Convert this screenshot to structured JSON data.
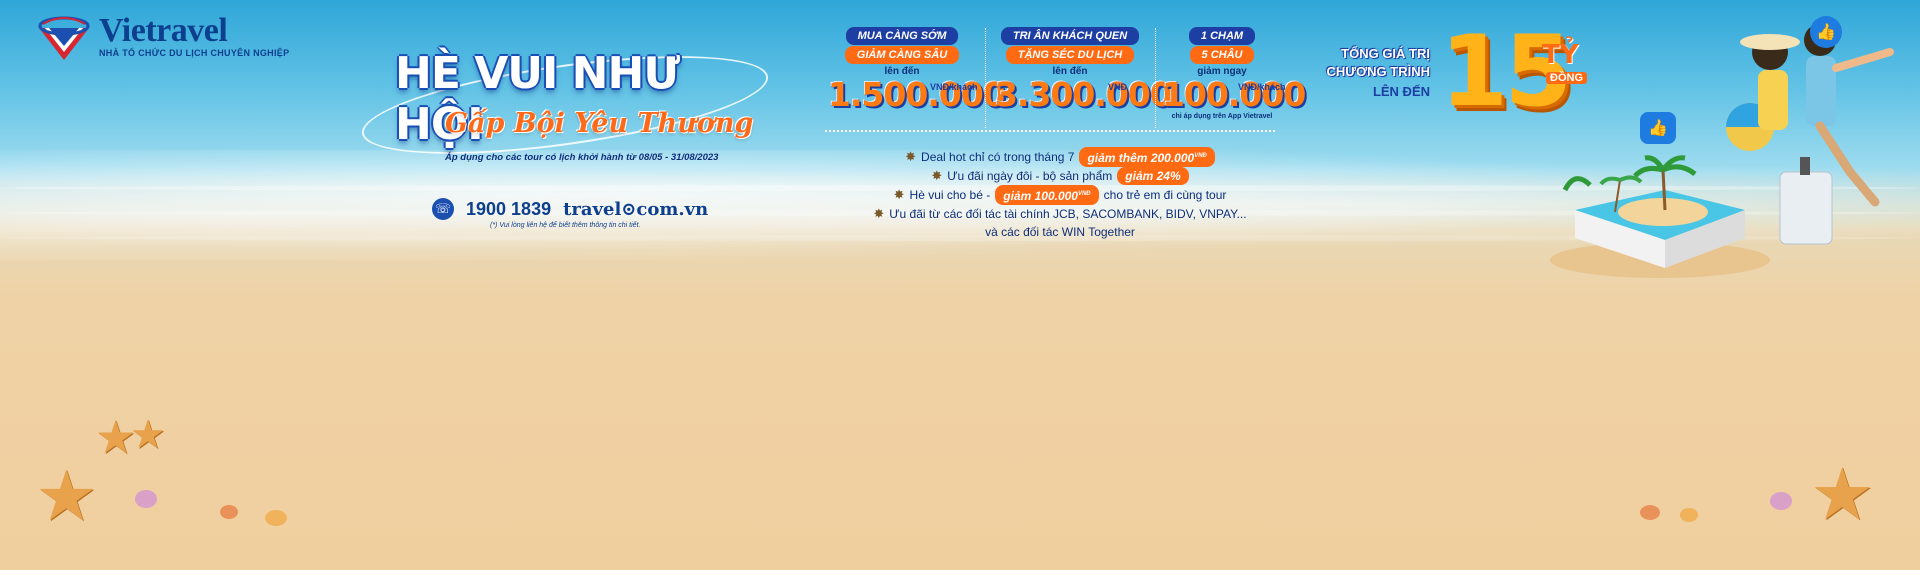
{
  "brand": {
    "name": "Vietravel",
    "tagline": "NHÀ TỔ CHỨC DU LỊCH CHUYÊN NGHIỆP",
    "logo_icon": "vietravel-logo-icon"
  },
  "campaign": {
    "title": "HÈ VUI NHƯ HỘI",
    "subtitle": "Gấp Bội Yêu Thương",
    "note": "Áp dụng cho các tour có lịch khởi hành từ 08/05 - 31/08/2023"
  },
  "contact": {
    "phone_icon": "phone-icon",
    "phone": "1900 1839",
    "website": "travel⊙com.vn",
    "note": "(*) Vui lòng liên hệ để biết thêm thông tin chi tiết."
  },
  "promos": [
    {
      "line1": "MUA CÀNG SỚM",
      "line2": "GIẢM CÀNG SÂU",
      "pre": "lên đến",
      "amount": "1.500.000",
      "unit": "VNĐ/khách",
      "foot": ""
    },
    {
      "line1": "TRI ÂN KHÁCH QUEN",
      "line2": "TẶNG SÉC DU LỊCH",
      "pre": "lên đến",
      "amount": "3.300.000",
      "unit": "VNĐ",
      "foot": ""
    },
    {
      "line1": "1 CHẠM",
      "line2": "5 CHÂU",
      "pre": "giảm ngay",
      "amount": "100.000",
      "unit": "VNĐ/khách",
      "foot": "chỉ áp dụng trên App Vietravel"
    }
  ],
  "perks": [
    {
      "before": "Deal hot chỉ có trong tháng 7",
      "tag": "giảm thêm 200.000",
      "tag_sup": "VNĐ",
      "after": ""
    },
    {
      "before": "Ưu đãi ngày đôi - bộ sản phẩm",
      "tag": "giảm 24%",
      "tag_sup": "",
      "after": ""
    },
    {
      "before": "Hè vui cho bé -",
      "tag": "giảm 100.000",
      "tag_sup": "VNĐ",
      "after": "cho trẻ em đi cùng tour"
    },
    {
      "before": "Ưu đãi từ các đối tác tài chính JCB, SACOMBANK, BIDV, VNPAY...",
      "tag": "",
      "tag_sup": "",
      "after": ""
    },
    {
      "before": "và các đối tác WIN Together",
      "tag": "",
      "tag_sup": "",
      "after": ""
    }
  ],
  "grand": {
    "line1": "TỔNG GIÁ TRỊ",
    "line2": "CHƯƠNG TRÌNH",
    "line3": "LÊN ĐẾN",
    "number": "15",
    "unit": "TỶ",
    "unit2": "ĐỒNG"
  },
  "colors": {
    "navy": "#0d3f8f",
    "orange": "#ff6a13",
    "gold": "#ffb319",
    "sand": "#f0cf9e"
  }
}
